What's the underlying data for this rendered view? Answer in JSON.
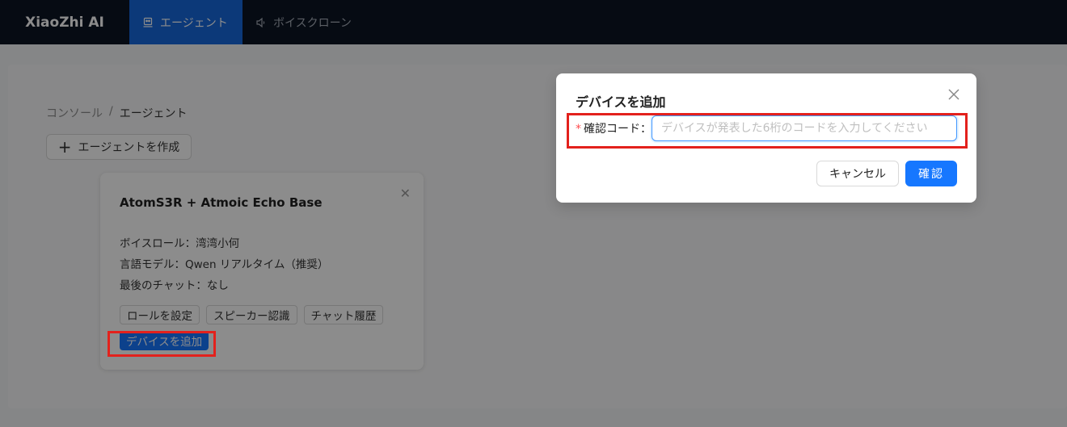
{
  "navbar": {
    "brand": "XiaoZhi AI",
    "items": [
      {
        "label": "エージェント",
        "icon": "robot-icon",
        "active": true
      },
      {
        "label": "ボイスクローン",
        "icon": "speaker-icon",
        "active": false
      }
    ]
  },
  "breadcrumb": {
    "root": "コンソール",
    "separator": "/",
    "current": "エージェント"
  },
  "toolbar": {
    "create_label": "エージェントを作成"
  },
  "agent_card": {
    "title": "AtomS3R + Atmoic Echo Base",
    "voice_role": "ボイスロール：湾湾小何",
    "language_model": "言語モデル：Qwen リアルタイム（推奨）",
    "last_chat": "最後のチャット：なし",
    "actions": {
      "set_role": "ロールを設定",
      "speaker_recognition": "スピーカー認識",
      "chat_history": "チャット履歴",
      "add_device": "デバイスを追加"
    }
  },
  "modal": {
    "title": "デバイスを追加",
    "field_label": "確認コード：",
    "required_mark": "*",
    "input_value": "",
    "input_placeholder": "デバイスが発表した6桁のコードを入力してください",
    "cancel_label": "キャンセル",
    "confirm_label": "確認"
  },
  "colors": {
    "navbar_bg": "#0c1424",
    "primary": "#1677ff",
    "highlight": "#e3211c"
  }
}
